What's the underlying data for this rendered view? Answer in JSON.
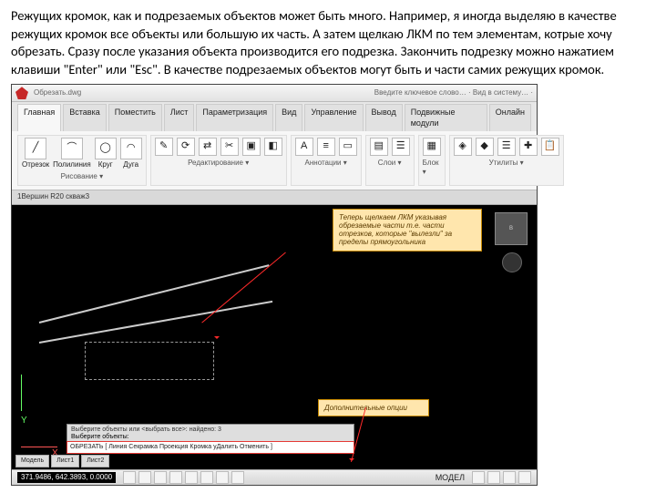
{
  "intro_text": "Режущих кромок, как и подрезаемых объектов может быть много. Например, я иногда выделяю в качестве режущих кромок все объекты или большую их часть. А затем щелкаю ЛКМ по тем элементам, котрые хочу обрезать. Сразу после указания объекта производится его подрезка. Закончить подрезку можно нажатием клавиши \"Enter\" или \"Esc\". В качестве подрезаемых объектов могут быть и части самих режущих кромок.",
  "window": {
    "title_hint": "Обрезать.dwg",
    "qat": "Введите ключевое слово… · Вид в систему… ·",
    "tabs": [
      "Главная",
      "Вставка",
      "Поместить",
      "Лист",
      "Параметризация",
      "Вид",
      "Управление",
      "Вывод",
      "Подвижные модули",
      "Онлайн"
    ],
    "panels": {
      "draw": {
        "big": [
          {
            "icon": "╱",
            "label": "Отрезок"
          },
          {
            "icon": "⌒",
            "label": "Полилиния"
          },
          {
            "icon": "◯",
            "label": "Круг"
          },
          {
            "icon": "◠",
            "label": "Дуга"
          }
        ],
        "group_label": "Рисование ▾"
      },
      "modify": {
        "icons": [
          "✎",
          "⟳",
          "⇄",
          "✂",
          "▣",
          "◧"
        ],
        "group_label": "Редактирование ▾"
      },
      "annot": {
        "icons": [
          "A",
          "≡",
          "▭"
        ],
        "group_label": "Аннотации ▾"
      },
      "layers": {
        "icons": [
          "▤",
          "☰"
        ],
        "group_label": "Слои ▾"
      },
      "block": {
        "icons": [
          "▦"
        ],
        "group_label": "Блок ▾"
      },
      "utils": {
        "icons": [
          "◈",
          "◆",
          "☰",
          "✚",
          "📋"
        ],
        "group_label": "Утилиты ▾"
      }
    },
    "doc_tab": "1Вершин R20 скваж3",
    "viewcube": "В",
    "callout_top": "Теперь щелкаем ЛКМ указывая обрезаемые части т.е. части отрезков, которые \"вылезли\" за пределы прямоугольника",
    "callout_bottom": "Дополнительные опции",
    "cmd_line1": "Выберите объекты или <выбрать все>: найдено: 3",
    "cmd_line2": "Выберите объекты:",
    "cmd_prompt": "ОБРЕЗАТЬ [ Линия Секрамка Проекция Кромка уДалить Отменить ]",
    "layout_tabs": [
      "Модель",
      "Лист1",
      "Лист2"
    ],
    "coords": "371.9486, 642.3893, 0.0000",
    "status_mode": "МОДЕЛ"
  }
}
